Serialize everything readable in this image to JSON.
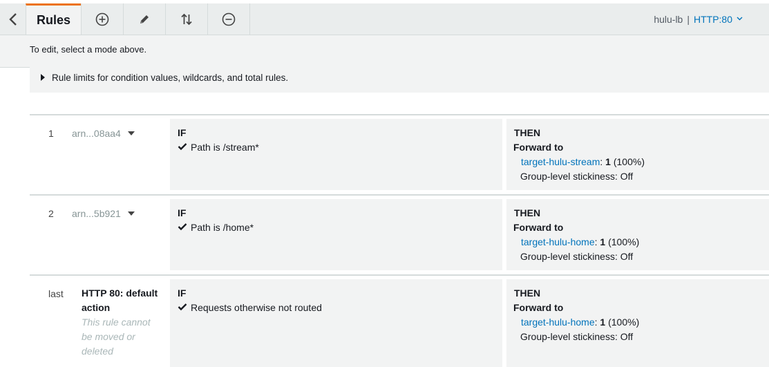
{
  "toolbar": {
    "active_tab": "Rules",
    "tools": [
      {
        "name": "add-rules",
        "icon": "plus-circle-icon"
      },
      {
        "name": "edit-rules",
        "icon": "pencil-icon"
      },
      {
        "name": "reorder-rules",
        "icon": "reorder-arrows-icon"
      },
      {
        "name": "delete-rules",
        "icon": "minus-circle-icon"
      }
    ],
    "load_balancer": "hulu-lb",
    "separator": "|",
    "listener": "HTTP:80",
    "accent_color": "#ec7211",
    "link_color": "#0073bb"
  },
  "hint": "To edit, select a mode above.",
  "limits_label": "Rule limits for condition values, wildcards, and total rules.",
  "rules": [
    {
      "priority": "1",
      "arn": "arn...08aa4",
      "if_label": "IF",
      "condition": "Path is /stream*",
      "then_label": "THEN",
      "action": "Forward to",
      "target_group": "target-hulu-stream",
      "weight_sep": ":",
      "weight": "1",
      "percent": "(100%)",
      "stickiness": "Group-level stickiness: Off"
    },
    {
      "priority": "2",
      "arn": "arn...5b921",
      "if_label": "IF",
      "condition": "Path is /home*",
      "then_label": "THEN",
      "action": "Forward to",
      "target_group": "target-hulu-home",
      "weight_sep": ":",
      "weight": "1",
      "percent": "(100%)",
      "stickiness": "Group-level stickiness: Off"
    }
  ],
  "default_rule": {
    "priority": "last",
    "name": "HTTP 80: default action",
    "note": "This rule cannot be moved or deleted",
    "if_label": "IF",
    "condition": "Requests otherwise not routed",
    "then_label": "THEN",
    "action": "Forward to",
    "target_group": "target-hulu-home",
    "weight_sep": ":",
    "weight": "1",
    "percent": "(100%)",
    "stickiness": "Group-level stickiness: Off"
  }
}
